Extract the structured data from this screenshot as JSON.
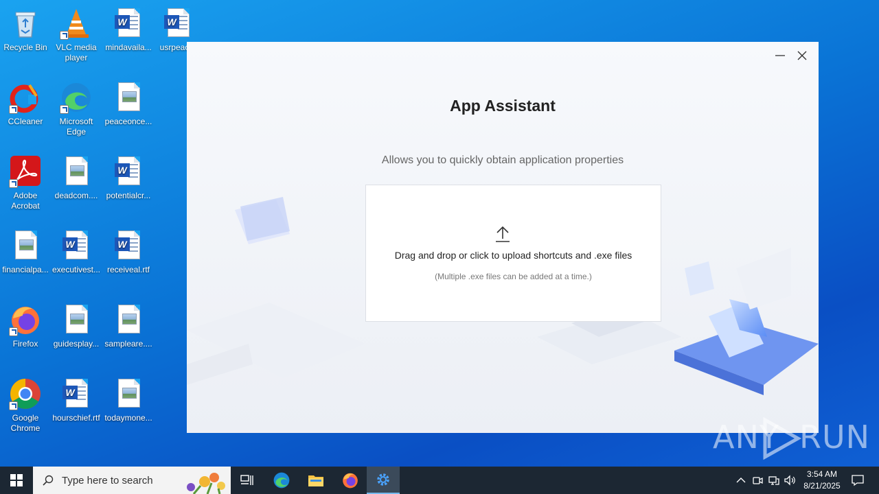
{
  "desktop": {
    "icons": [
      {
        "label": "Recycle Bin"
      },
      {
        "label": "VLC media player"
      },
      {
        "label": "mindavaila..."
      },
      {
        "label": "usrpeac..."
      },
      {
        "label": "CCleaner"
      },
      {
        "label": "Microsoft Edge"
      },
      {
        "label": "peaceonce..."
      },
      {
        "label": "Adobe Acrobat"
      },
      {
        "label": "deadcom...."
      },
      {
        "label": "potentialcr..."
      },
      {
        "label": "financialpa..."
      },
      {
        "label": "executivest..."
      },
      {
        "label": "receiveal.rtf"
      },
      {
        "label": "Firefox"
      },
      {
        "label": "guidesplay..."
      },
      {
        "label": "sampleare...."
      },
      {
        "label": "Google Chrome"
      },
      {
        "label": "hourschief.rtf"
      },
      {
        "label": "todaymone..."
      }
    ]
  },
  "app": {
    "title": "App Assistant",
    "subtitle": "Allows you to quickly obtain application properties",
    "drop_text": "Drag and drop or click to upload shortcuts and .exe files",
    "drop_hint": "(Multiple .exe files can be added at a time.)",
    "icons": {
      "minimize": "minimize-icon",
      "close": "close-icon",
      "upload": "upload-arrow-icon"
    }
  },
  "watermark": {
    "text_left": "ANY",
    "text_right": "RUN"
  },
  "taskbar": {
    "search_placeholder": "Type here to search",
    "clock_time": "3:54 AM",
    "clock_date": "8/21/2025",
    "accent": "#76b9ed"
  }
}
